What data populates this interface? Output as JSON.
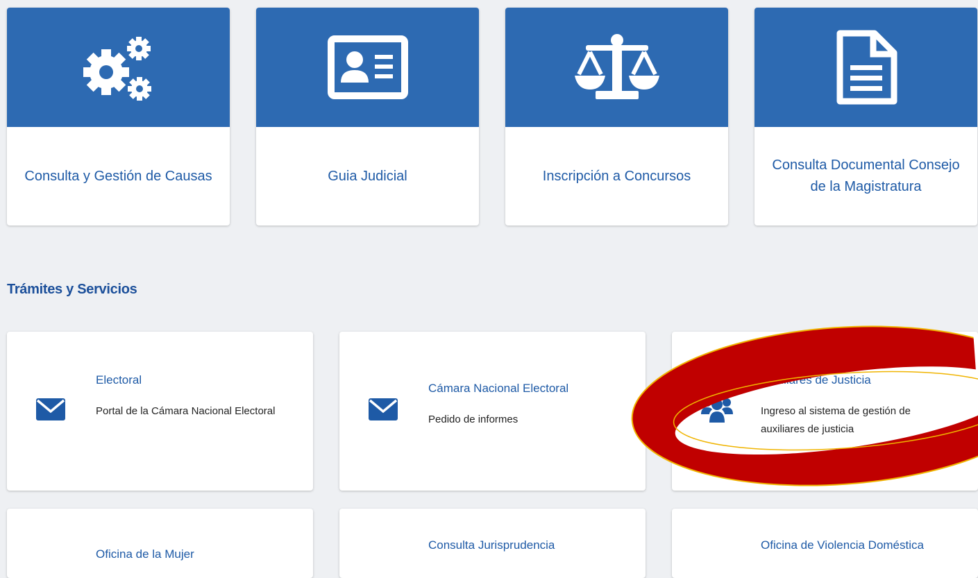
{
  "colors": {
    "brand_blue": "#2d6ab2",
    "link_blue": "#1e5aa6",
    "heading_blue": "#1b4f9a",
    "page_background": "#eef0f3",
    "highlight_red": "#c00000",
    "highlight_outline": "#f0b400"
  },
  "top_cards": [
    {
      "label": "Consulta y Gestión de Causas",
      "icon": "gears-icon"
    },
    {
      "label": "Guia Judicial",
      "icon": "id-card-icon"
    },
    {
      "label": "Inscripción a Concursos",
      "icon": "scales-icon"
    },
    {
      "label": "Consulta Documental Consejo de la Magistratura",
      "icon": "document-icon"
    }
  ],
  "section": {
    "title": "Trámites y Servicios"
  },
  "services": [
    {
      "title": "Electoral",
      "description": "Portal de la Cámara Nacional Electoral",
      "icon": "envelope-icon"
    },
    {
      "title": "Cámara Nacional Electoral",
      "description": "Pedido de informes",
      "icon": "envelope-icon"
    },
    {
      "title": "Auxiliares de Justicia",
      "description": "Ingreso al sistema de gestión de auxiliares de justicia",
      "icon": "users-icon",
      "highlighted": true
    },
    {
      "title": "Oficina de la Mujer",
      "description": ""
    },
    {
      "title": "Consulta Jurisprudencia",
      "description": ""
    },
    {
      "title": "Oficina de Violencia Doméstica",
      "description": ""
    }
  ]
}
